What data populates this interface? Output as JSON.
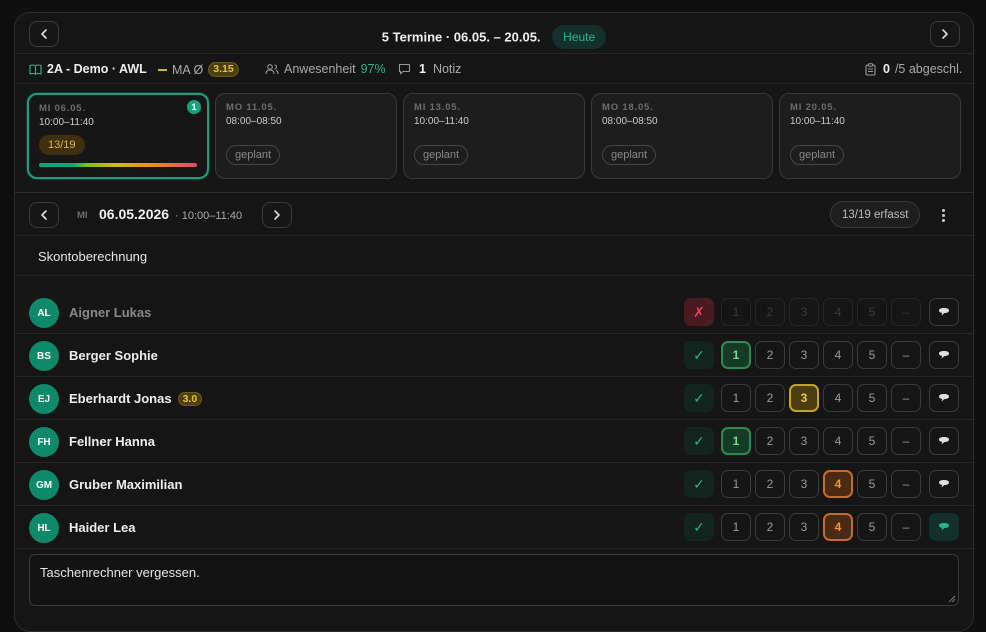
{
  "header": {
    "title": "5 Termine · 06.05. – 20.05.",
    "today_label": "Heute"
  },
  "info": {
    "class_name": "2A - Demo · AWL",
    "ma_label": "MA Ø",
    "ma_value": "3.15",
    "attendance_label": "Anwesenheit",
    "attendance_value": "97%",
    "notes_count": "1",
    "notes_label": "Notiz",
    "closed_count": "0",
    "closed_label": "/5 abgeschl."
  },
  "sessions": [
    {
      "day": "MI 06.05.",
      "time": "10:00–11:40",
      "status": "13/19",
      "badge": "1",
      "active": true
    },
    {
      "day": "MO 11.05.",
      "time": "08:00–08:50",
      "status": "geplant"
    },
    {
      "day": "MI 13.05.",
      "time": "10:00–11:40",
      "status": "geplant"
    },
    {
      "day": "MO 18.05.",
      "time": "08:00–08:50",
      "status": "geplant"
    },
    {
      "day": "MI 20.05.",
      "time": "10:00–11:40",
      "status": "geplant"
    }
  ],
  "current": {
    "dow": "MI",
    "date": "06.05.2026",
    "time": "· 10:00–11:40",
    "erfasst": "13/19 erfasst"
  },
  "topic": "Skontoberechnung",
  "grade_labels": [
    "1",
    "2",
    "3",
    "4",
    "5",
    "–"
  ],
  "present_symbol": "✓",
  "absent_symbol": "✗",
  "students": [
    {
      "initials": "AL",
      "name": "Aigner Lukas",
      "present": false,
      "grade": null,
      "note": false
    },
    {
      "initials": "BS",
      "name": "Berger Sophie",
      "present": true,
      "grade": "1",
      "note": false
    },
    {
      "initials": "EJ",
      "name": "Eberhardt Jonas",
      "present": true,
      "grade": "3",
      "note": false,
      "avg": "3.0"
    },
    {
      "initials": "FH",
      "name": "Fellner Hanna",
      "present": true,
      "grade": "1",
      "note": false
    },
    {
      "initials": "GM",
      "name": "Gruber Maximilian",
      "present": true,
      "grade": "4",
      "note": false
    },
    {
      "initials": "HL",
      "name": "Haider Lea",
      "present": true,
      "grade": "4",
      "note": true
    }
  ],
  "note_text": "Taschenrechner vergessen."
}
